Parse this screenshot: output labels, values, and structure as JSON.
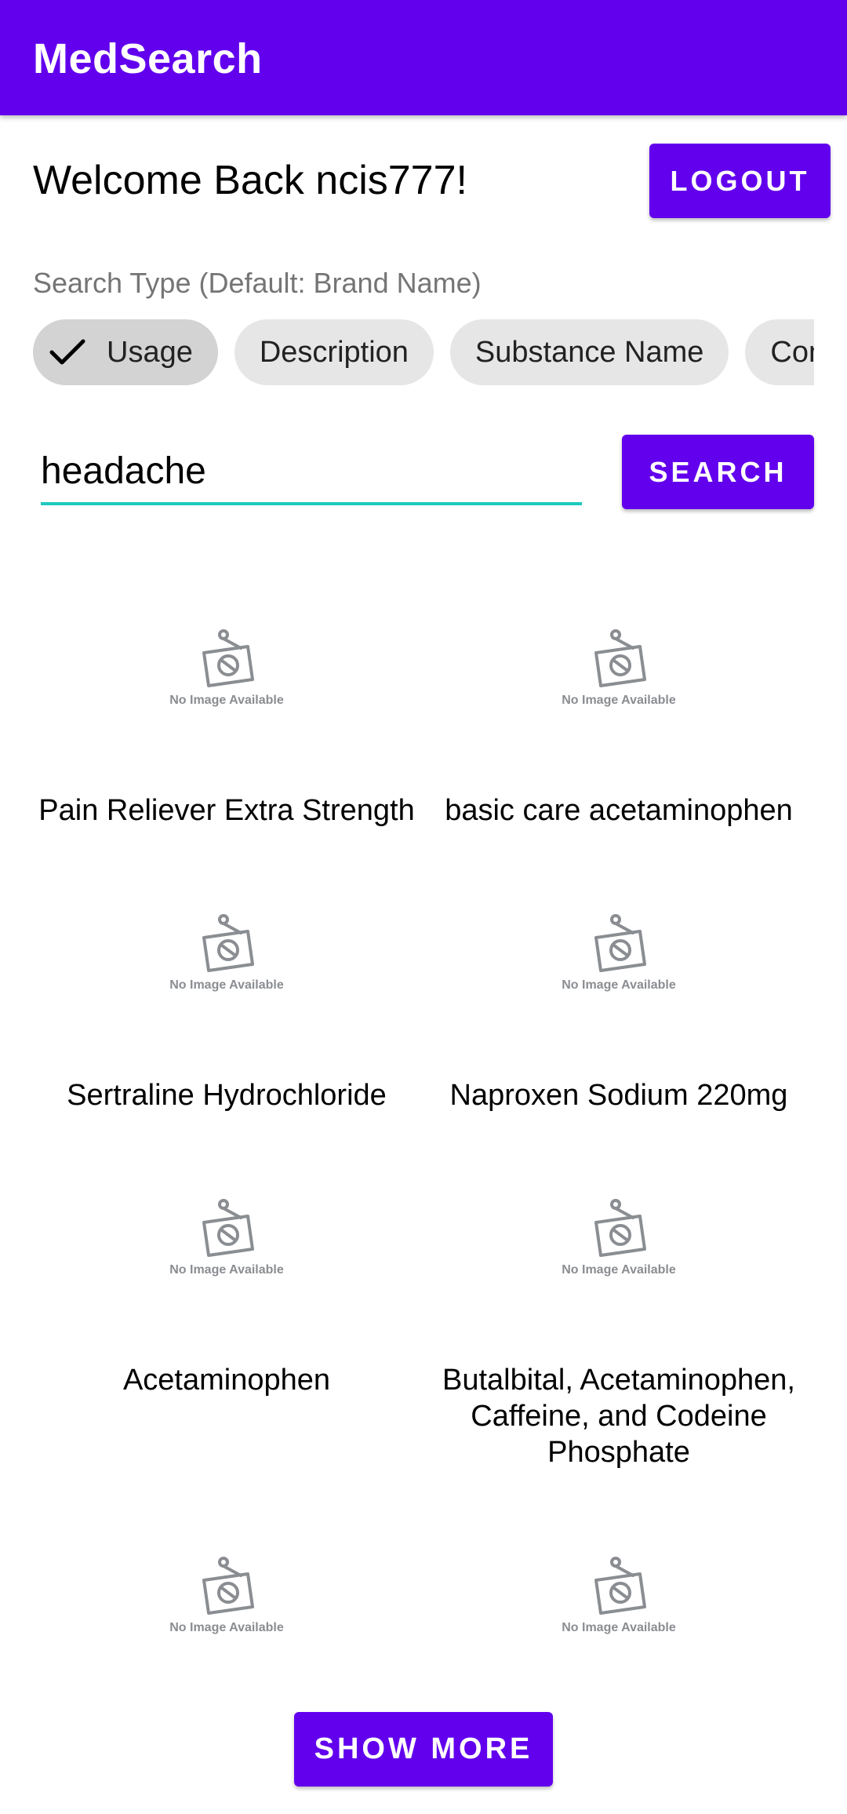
{
  "app_bar": {
    "title": "MedSearch"
  },
  "welcome_text": "Welcome Back ncis777!",
  "logout_label": "LOGOUT",
  "search_type": {
    "label": "Search Type (Default: Brand Name)",
    "chips": [
      {
        "label": "Usage",
        "selected": true
      },
      {
        "label": "Description",
        "selected": false
      },
      {
        "label": "Substance Name",
        "selected": false
      },
      {
        "label": "Con",
        "selected": false
      }
    ]
  },
  "search": {
    "value": "headache",
    "button_label": "SEARCH"
  },
  "results": {
    "image_placeholder_text": "No Image Available",
    "items": [
      {
        "name": "Pain Reliever Extra Strength"
      },
      {
        "name": "basic care acetaminophen"
      },
      {
        "name": "Sertraline Hydrochloride"
      },
      {
        "name": "Naproxen Sodium 220mg"
      },
      {
        "name": "Acetaminophen"
      },
      {
        "name": "Butalbital, Acetaminophen, Caffeine, and Codeine Phosphate"
      },
      {
        "name": ""
      },
      {
        "name": ""
      }
    ]
  },
  "show_more_label": "SHOW MORE",
  "colors": {
    "primary": "#6200ee",
    "accent_underline": "#1ec9bf",
    "chip_bg": "#e6e6e6",
    "chip_selected_bg": "#d3d3d3"
  }
}
